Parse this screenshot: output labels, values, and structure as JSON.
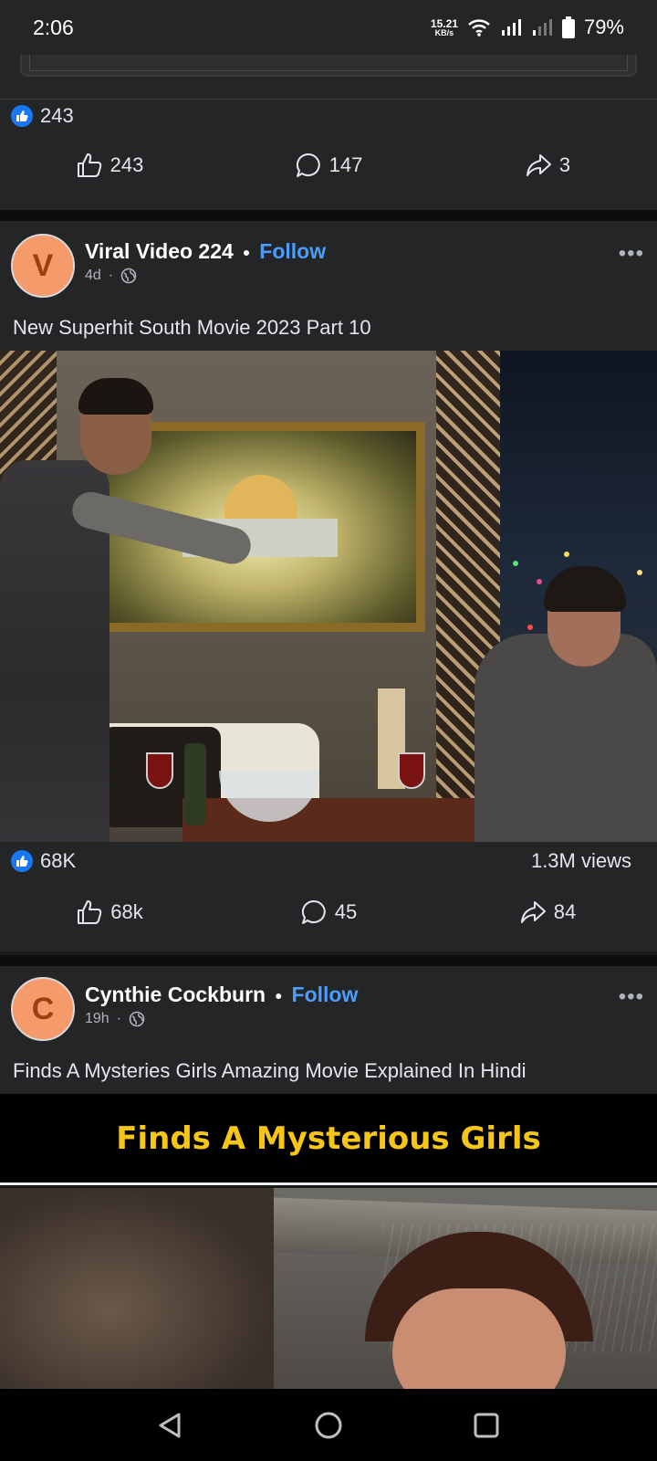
{
  "status_bar": {
    "time": "2:06",
    "net_speed_value": "15.21",
    "net_speed_unit": "KB/s",
    "battery": "79%",
    "icons": [
      "wifi-icon",
      "signal-icon",
      "signal-weak-icon",
      "battery-icon"
    ]
  },
  "post1": {
    "reaction_count": "243",
    "actions": {
      "like": "243",
      "comment": "147",
      "share": "3"
    }
  },
  "post2": {
    "avatar_letter": "V",
    "author": "Viral Video 224",
    "follow": "Follow",
    "time": "4d",
    "caption": "New Superhit South Movie 2023 Part 10",
    "reaction_count": "68K",
    "views": "1.3M views",
    "actions": {
      "like": "68k",
      "comment": "45",
      "share": "84"
    }
  },
  "post3": {
    "avatar_letter": "C",
    "author": "Cynthie Cockburn",
    "follow": "Follow",
    "time": "19h",
    "caption": "Finds A Mysteries Girls Amazing Movie Explained In Hindi",
    "video_title": "Finds A Mysterious Girls"
  },
  "colors": {
    "background": "#18191a",
    "card": "#242526",
    "accent": "#4a9dfa",
    "like_blue": "#1877f2",
    "avatar": "#f59a6b",
    "video_title": "#f5c518"
  }
}
